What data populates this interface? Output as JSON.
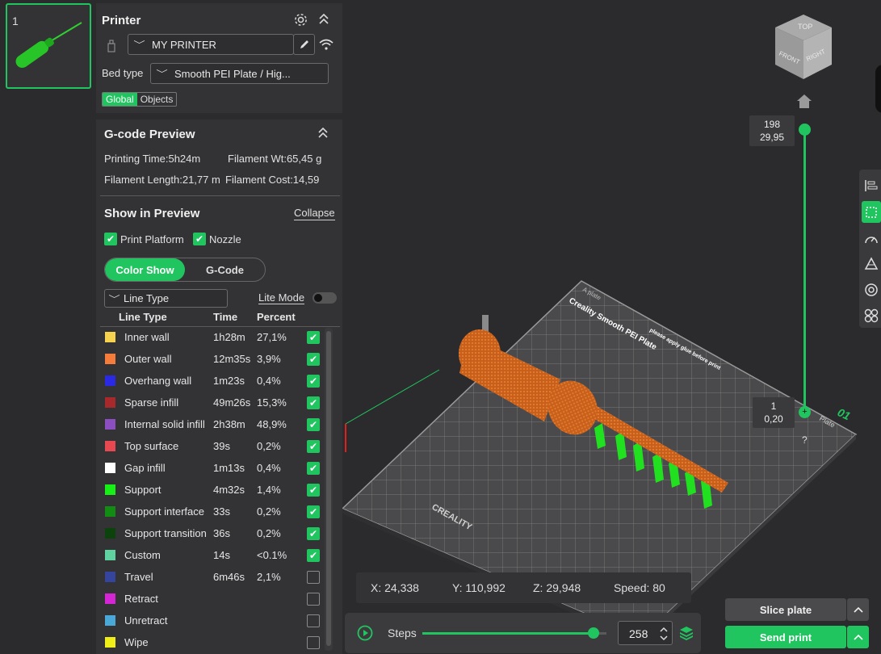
{
  "plate_thumb": {
    "number": "1"
  },
  "printer": {
    "title": "Printer",
    "printer_name": "MY PRINTER",
    "bed_type_label": "Bed type",
    "bed_type_value": "Smooth PEI Plate / Hig...",
    "scope_tabs": [
      "Global",
      "Objects"
    ]
  },
  "gcode": {
    "title": "G-code Preview",
    "printing_time": "Printing Time:5h24m",
    "filament_wt": "Filament Wt:65,45 g",
    "filament_length": "Filament Length:21,77 m",
    "filament_cost": "Filament Cost:14,59"
  },
  "show_preview": {
    "title": "Show in Preview",
    "collapse_label": "Collapse",
    "print_platform_label": "Print Platform",
    "nozzle_label": "Nozzle",
    "mode_tabs": [
      "Color Show",
      "G-Code"
    ],
    "line_type_select": "Line Type",
    "lite_mode_label": "Lite Mode",
    "headers": {
      "type": "Line Type",
      "time": "Time",
      "percent": "Percent"
    },
    "rows": [
      {
        "name": "Inner wall",
        "time": "1h28m",
        "percent": "27,1%",
        "color": "#f5d34f",
        "checked": true
      },
      {
        "name": "Outer wall",
        "time": "12m35s",
        "percent": "3,9%",
        "color": "#f57c3a",
        "checked": true
      },
      {
        "name": "Overhang wall",
        "time": "1m23s",
        "percent": "0,4%",
        "color": "#2a2ae6",
        "checked": true
      },
      {
        "name": "Sparse infill",
        "time": "49m26s",
        "percent": "15,3%",
        "color": "#a8292b",
        "checked": true
      },
      {
        "name": "Internal solid infill",
        "time": "2h38m",
        "percent": "48,9%",
        "color": "#8b4fc2",
        "checked": true
      },
      {
        "name": "Top surface",
        "time": "39s",
        "percent": "0,2%",
        "color": "#e84850",
        "checked": true
      },
      {
        "name": "Gap infill",
        "time": "1m13s",
        "percent": "0,4%",
        "color": "#ffffff",
        "checked": true
      },
      {
        "name": "Support",
        "time": "4m32s",
        "percent": "1,4%",
        "color": "#16f016",
        "checked": true
      },
      {
        "name": "Support interface",
        "time": "33s",
        "percent": "0,2%",
        "color": "#138c13",
        "checked": true
      },
      {
        "name": "Support transition",
        "time": "36s",
        "percent": "0,2%",
        "color": "#0c420c",
        "checked": true
      },
      {
        "name": "Custom",
        "time": "14s",
        "percent": "<0.1%",
        "color": "#5fd2a0",
        "checked": true
      },
      {
        "name": "Travel",
        "time": "6m46s",
        "percent": "2,1%",
        "color": "#35449c",
        "checked": false
      },
      {
        "name": "Retract",
        "time": "",
        "percent": "",
        "color": "#d426d4",
        "checked": false
      },
      {
        "name": "Unretract",
        "time": "",
        "percent": "",
        "color": "#4aa8d8",
        "checked": false
      },
      {
        "name": "Wipe",
        "time": "",
        "percent": "",
        "color": "#f0ee19",
        "checked": false
      }
    ]
  },
  "viewport": {
    "view_cube": {
      "top": "TOP",
      "front": "FRONT",
      "right": "RIGHT"
    },
    "plate_title": "Creality Smooth PEI Plate",
    "plate_note": "please apply glue before print",
    "plate_brand": "CREALITY",
    "plate_label": "A plate",
    "plate_number": "01",
    "plate_name_tag": "Plate",
    "layer_top": {
      "layer": "198",
      "height": "29,95"
    },
    "layer_bottom": {
      "layer": "1",
      "height": "0,20"
    },
    "help_mark": "?"
  },
  "coords": {
    "x": "X: 24,338",
    "y": "Y: 110,992",
    "z": "Z: 29,948",
    "speed": "Speed: 80"
  },
  "steps": {
    "label": "Steps",
    "value": "258",
    "progress_fraction": 0.93
  },
  "actions": {
    "slice": "Slice plate",
    "send": "Send print"
  },
  "colors": {
    "accent": "#21c560",
    "panel": "#333336",
    "background": "#2b2b2d"
  }
}
